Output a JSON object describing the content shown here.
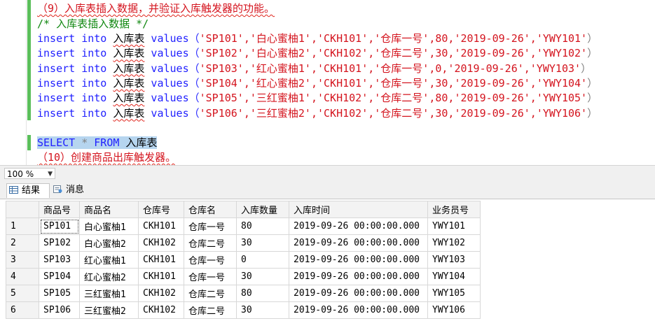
{
  "editor": {
    "line_comment_9": "（9）入库表插入数据，并验证入库触发器的功能。",
    "line_comment_block": "/* 入库表插入数据 */",
    "insert_rows": [
      {
        "pre": "insert into ",
        "table": "入库表",
        "mid": " values（",
        "vals": "'SP101','白心蜜柚1','CKH101','仓库一号',80,'2019-09-26','YWY101'",
        "end": "）"
      },
      {
        "pre": "insert into ",
        "table": "入库表",
        "mid": " values（",
        "vals": "'SP102','白心蜜柚2','CKH102','仓库二号',30,'2019-09-26','YWY102'",
        "end": "）"
      },
      {
        "pre": "insert into ",
        "table": "入库表",
        "mid": " values（",
        "vals": "'SP103','红心蜜柚1','CKH101','仓库一号',0,'2019-09-26','YWY103'",
        "end": "）"
      },
      {
        "pre": "insert into ",
        "table": "入库表",
        "mid": " values（",
        "vals": "'SP104','红心蜜柚2','CKH101','仓库一号',30,'2019-09-26','YWY104'",
        "end": "）"
      },
      {
        "pre": "insert into ",
        "table": "入库表",
        "mid": " values（",
        "vals": "'SP105','三红蜜柚1','CKH102','仓库二号',80,'2019-09-26','YWY105'",
        "end": "）"
      },
      {
        "pre": "insert into ",
        "table": "入库表",
        "mid": " values（",
        "vals": "'SP106','三红蜜柚2','CKH102','仓库二号',30,'2019-09-26','YWY106'",
        "end": "）"
      }
    ],
    "select_kw1": "SELECT",
    "select_star": " * ",
    "select_kw2": "FROM",
    "select_table": " 入库表",
    "line_comment_10": "（10）创建商品出库触发器。"
  },
  "zoom": {
    "value": "100 %"
  },
  "tabs": {
    "results": "结果",
    "messages": "消息"
  },
  "grid": {
    "columns": [
      "商品号",
      "商品名",
      "仓库号",
      "仓库名",
      "入库数量",
      "入库时间",
      "业务员号"
    ],
    "rows": [
      [
        "1",
        "SP101",
        "白心蜜柚1",
        "CKH101",
        "仓库一号",
        "80",
        "2019-09-26 00:00:00.000",
        "YWY101"
      ],
      [
        "2",
        "SP102",
        "白心蜜柚2",
        "CKH102",
        "仓库二号",
        "30",
        "2019-09-26 00:00:00.000",
        "YWY102"
      ],
      [
        "3",
        "SP103",
        "红心蜜柚1",
        "CKH101",
        "仓库一号",
        "0",
        "2019-09-26 00:00:00.000",
        "YWY103"
      ],
      [
        "4",
        "SP104",
        "红心蜜柚2",
        "CKH101",
        "仓库一号",
        "30",
        "2019-09-26 00:00:00.000",
        "YWY104"
      ],
      [
        "5",
        "SP105",
        "三红蜜柚1",
        "CKH102",
        "仓库二号",
        "80",
        "2019-09-26 00:00:00.000",
        "YWY105"
      ],
      [
        "6",
        "SP106",
        "三红蜜柚2",
        "CKH102",
        "仓库二号",
        "30",
        "2019-09-26 00:00:00.000",
        "YWY106"
      ]
    ]
  },
  "colors": {
    "keyword": "#1f1fff",
    "string": "#d4141e",
    "comment": "#118811",
    "selection": "#b6d5ef",
    "change_bar": "#5bbf5b"
  }
}
